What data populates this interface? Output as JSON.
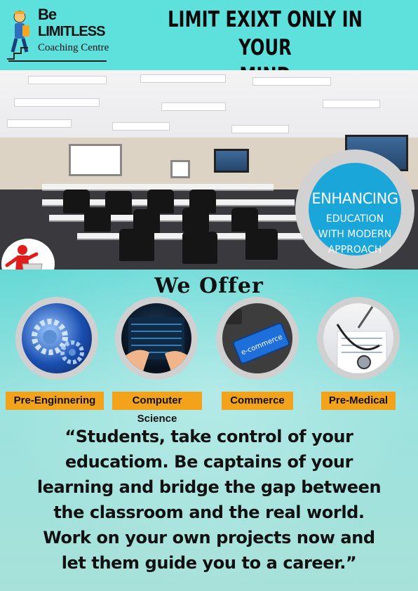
{
  "logo": {
    "line1": "Be",
    "line2": "LIMITLESS",
    "line3": "Coaching Centre"
  },
  "title": {
    "line1": "LIMIT EXIXT ONLY IN YOUR",
    "line2": "MIND"
  },
  "badge": {
    "line1": "ENHANCING",
    "line2": "EDUCATION",
    "line3": "WITH MODERN",
    "line4": "APPROACH"
  },
  "offer_heading": "We Offer",
  "courses": [
    {
      "label": "Pre-Enginnering",
      "icon": "gears-icon"
    },
    {
      "label": "Computer Science",
      "icon": "keyboard-hands-icon"
    },
    {
      "label": "Commerce",
      "icon": "ecommerce-key-icon"
    },
    {
      "label": "Pre-Medical",
      "icon": "stethoscope-icon"
    }
  ],
  "ecommerce_key_text": "e-commerce",
  "quote": {
    "line1": "“Students, take control of your",
    "line2": "educatiom. Be captains of your",
    "line3": "learning and bridge the gap between",
    "line4": "the classroom and the real world.",
    "line5": "Work on your own projects now and",
    "line6": "let them guide you to a career.”"
  },
  "colors": {
    "background": "#5ee0dd",
    "badge": "#1aa6d8",
    "label": "#f3a21b"
  }
}
